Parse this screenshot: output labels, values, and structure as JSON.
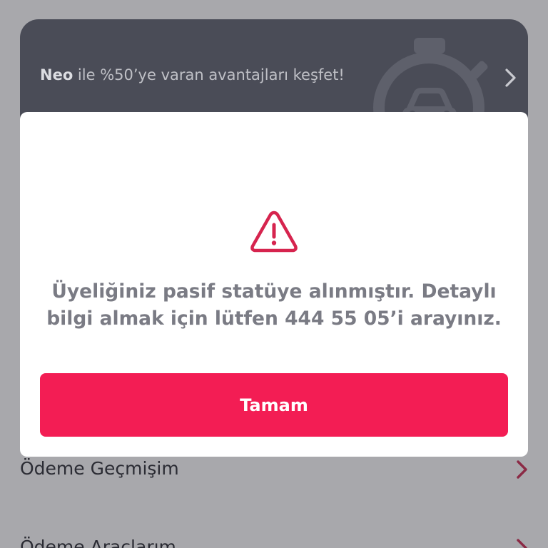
{
  "banner": {
    "brand": "Neo",
    "text": " ile %50’ye varan avantajları keşfet!",
    "art_icon": "stopwatch-car-icon",
    "chevron_icon": "chevron-right-icon"
  },
  "list": {
    "items": [
      {
        "label": "Ödeme Geçmişim",
        "icon": "chevron-right-icon"
      },
      {
        "label": "Ödeme Araçlarım",
        "icon": "chevron-right-icon"
      }
    ]
  },
  "modal": {
    "icon": "warning-triangle-icon",
    "message": "Üyeliğiniz pasif statüye alınmıştır. Detaylı bilgi almak için lütfen 444 55 05’i arayınız.",
    "button_label": "Tamam"
  },
  "colors": {
    "overlay_background": "#a8a8ac",
    "banner_background": "#4a4c57",
    "accent": "#f31d54",
    "warning": "#d6244e",
    "list_chevron": "#8b2a45"
  }
}
